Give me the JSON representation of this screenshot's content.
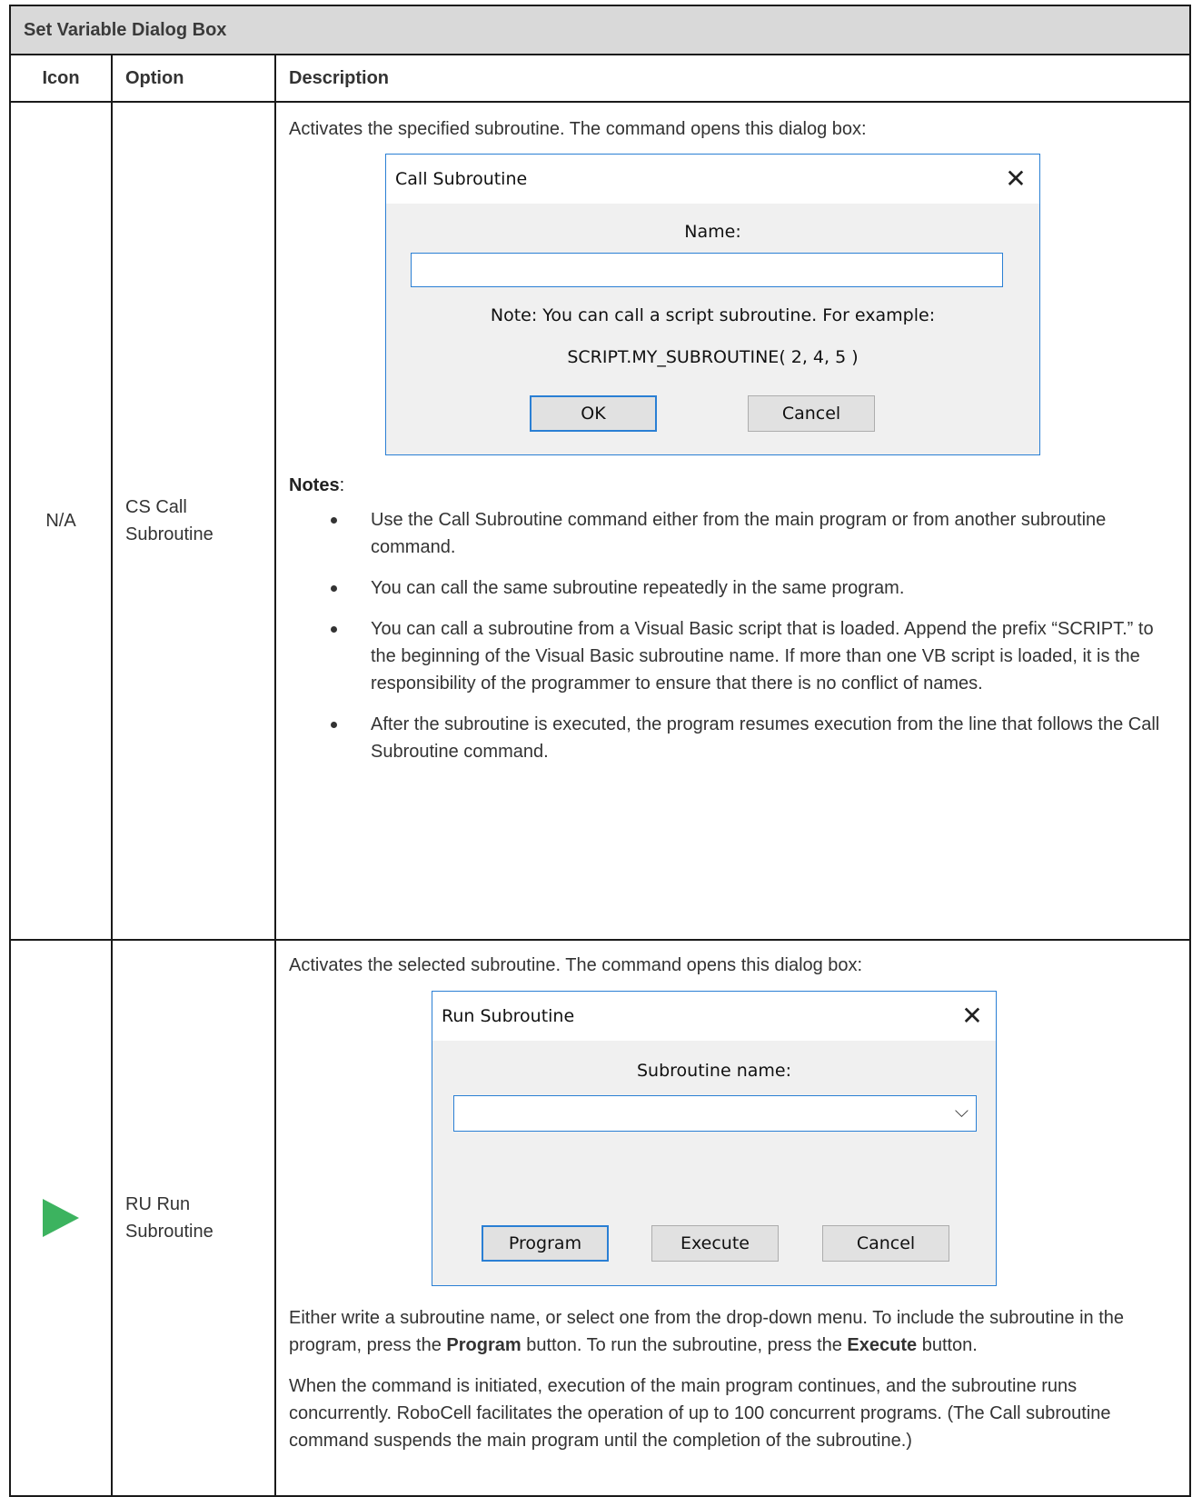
{
  "table": {
    "title": "Set Variable Dialog Box",
    "headers": {
      "icon": "Icon",
      "option": "Option",
      "description": "Description"
    },
    "rows": [
      {
        "icon_text": "N/A",
        "option": "CS Call\nSubroutine",
        "intro": "Activates the specified subroutine. The command opens this dialog box:",
        "dialog": {
          "title": "Call Subroutine",
          "close_symbol": "✕",
          "name_label": "Name:",
          "name_value": "",
          "note": "Note: You can call a script subroutine. For example:",
          "example": "SCRIPT.MY_SUBROUTINE( 2, 4, 5 )",
          "ok_label": "OK",
          "cancel_label": "Cancel"
        },
        "notes_title": "Notes",
        "notes_colon": ":",
        "notes": [
          "Use the Call Subroutine command either from the main program or from another subroutine command.",
          "You can call the same subroutine repeatedly in the same program.",
          "You can call a subroutine from a Visual Basic script that is loaded. Append the prefix “SCRIPT.” to the beginning of the Visual Basic subroutine name. If more than one VB script is loaded, it is the responsibility of the programmer to ensure that there is no conflict of names.",
          "After the subroutine is executed, the program resumes execution from the line that follows the Call Subroutine command."
        ]
      },
      {
        "icon": "play-icon",
        "icon_color": "#3cb35f",
        "option": "RU Run\nSubroutine",
        "intro": "Activates the selected subroutine. The command opens this dialog box:",
        "dialog": {
          "title": "Run Subroutine",
          "close_symbol": "✕",
          "name_label": "Subroutine name:",
          "name_value": "",
          "dropdown_symbol": "⌵",
          "program_label": "Program",
          "execute_label": "Execute",
          "cancel_label": "Cancel"
        },
        "para1": {
          "part1": "Either write a subroutine name, or select one from the drop-down menu. To include the subroutine in the program, press the ",
          "bold1": "Program",
          "part2": " button. To run the subroutine, press the ",
          "bold2": "Execute",
          "part3": " button."
        },
        "para2": "When the command is initiated, execution of the main program continues, and the subroutine runs concurrently. RoboCell facilitates the operation of up to 100 concurrent programs. (The Call subroutine command suspends the main program until the completion of the subroutine.)"
      }
    ]
  },
  "colors": {
    "accent_blue": "#2a7fd4",
    "header_gray": "#d9d9d9",
    "play_green": "#3cb35f"
  }
}
